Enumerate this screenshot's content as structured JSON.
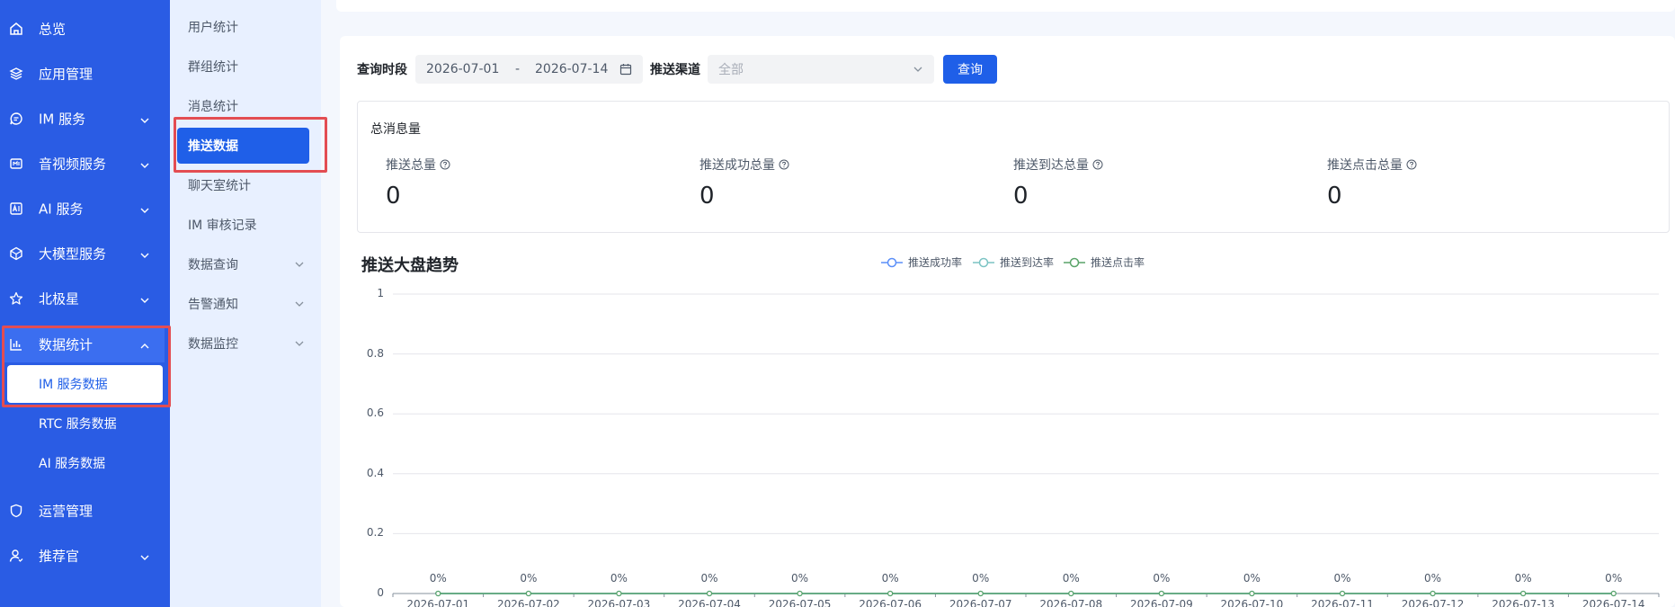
{
  "sidebar": {
    "items": [
      {
        "label": "总览",
        "icon": "home-icon",
        "expandable": false
      },
      {
        "label": "应用管理",
        "icon": "layers-icon",
        "expandable": false
      },
      {
        "label": "IM 服务",
        "icon": "chat-icon",
        "expandable": true
      },
      {
        "label": "音视频服务",
        "icon": "video-icon",
        "expandable": true
      },
      {
        "label": "AI 服务",
        "icon": "ai-icon",
        "expandable": true
      },
      {
        "label": "大模型服务",
        "icon": "cube-icon",
        "expandable": true
      },
      {
        "label": "北极星",
        "icon": "star-icon",
        "expandable": true
      },
      {
        "label": "数据统计",
        "icon": "bar-chart-icon",
        "expandable": true,
        "expanded": true
      },
      {
        "label": "运营管理",
        "icon": "shield-icon",
        "expandable": false
      },
      {
        "label": "推荐官",
        "icon": "user-icon",
        "expandable": true
      }
    ],
    "sub_items": [
      {
        "label": "IM 服务数据",
        "active": true
      },
      {
        "label": "RTC 服务数据",
        "active": false
      },
      {
        "label": "AI 服务数据",
        "active": false
      }
    ]
  },
  "subnav": {
    "items": [
      {
        "label": "用户统计",
        "active": false,
        "expandable": false
      },
      {
        "label": "群组统计",
        "active": false,
        "expandable": false
      },
      {
        "label": "消息统计",
        "active": false,
        "expandable": false
      },
      {
        "label": "推送数据",
        "active": true,
        "expandable": false
      },
      {
        "label": "聊天室统计",
        "active": false,
        "expandable": false
      },
      {
        "label": "IM 审核记录",
        "active": false,
        "expandable": false
      },
      {
        "label": "数据查询",
        "active": false,
        "expandable": true
      },
      {
        "label": "告警通知",
        "active": false,
        "expandable": true
      },
      {
        "label": "数据监控",
        "active": false,
        "expandable": true
      }
    ]
  },
  "filters": {
    "period_label": "查询时段",
    "date_start": "2026-07-01",
    "date_sep": "-",
    "date_end": "2026-07-14",
    "channel_label": "推送渠道",
    "channel_value": "全部",
    "query_button": "查询"
  },
  "stats": {
    "title": "总消息量",
    "items": [
      {
        "label": "推送总量",
        "value": "0"
      },
      {
        "label": "推送成功总量",
        "value": "0"
      },
      {
        "label": "推送到达总量",
        "value": "0"
      },
      {
        "label": "推送点击总量",
        "value": "0"
      }
    ]
  },
  "colors": {
    "sidebar_bg": "#2a5ce4",
    "accent": "#1f5fe8",
    "highlight_border": "#e34d52",
    "series_success": "#5b8ff9",
    "series_arrival": "#7cc4c4",
    "series_click": "#5aa469"
  },
  "chart_data": {
    "type": "line",
    "title": "推送大盘趋势",
    "x": [
      "2026-07-01",
      "2026-07-02",
      "2026-07-03",
      "2026-07-04",
      "2026-07-05",
      "2026-07-06",
      "2026-07-07",
      "2026-07-08",
      "2026-07-09",
      "2026-07-10",
      "2026-07-11",
      "2026-07-12",
      "2026-07-13",
      "2026-07-14"
    ],
    "series": [
      {
        "name": "推送成功率",
        "values": [
          0,
          0,
          0,
          0,
          0,
          0,
          0,
          0,
          0,
          0,
          0,
          0,
          0,
          0
        ]
      },
      {
        "name": "推送到达率",
        "values": [
          0,
          0,
          0,
          0,
          0,
          0,
          0,
          0,
          0,
          0,
          0,
          0,
          0,
          0
        ]
      },
      {
        "name": "推送点击率",
        "values": [
          0,
          0,
          0,
          0,
          0,
          0,
          0,
          0,
          0,
          0,
          0,
          0,
          0,
          0
        ]
      }
    ],
    "point_labels": [
      "0%",
      "0%",
      "0%",
      "0%",
      "0%",
      "0%",
      "0%",
      "0%",
      "0%",
      "0%",
      "0%",
      "0%",
      "0%",
      "0%"
    ],
    "y_ticks": [
      "0",
      "0.2",
      "0.4",
      "0.6",
      "0.8",
      "1"
    ],
    "ylim": [
      0,
      1
    ],
    "grid": true,
    "legend_position": "top-center"
  }
}
